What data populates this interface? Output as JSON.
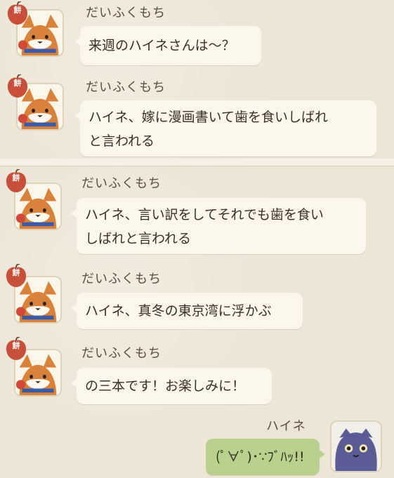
{
  "messages": [
    {
      "sender": "だいふくもち",
      "lines": [
        "来週のハイネさんは〜？"
      ],
      "badge": "餅"
    },
    {
      "sender": "だいふくもち",
      "lines": [
        "ハイネ、嫁に漫画書いて歯を食いしばれ",
        "と言われる"
      ],
      "badge": "餅"
    },
    {
      "sender": "だいふくもち",
      "lines": [
        "ハイネ、言い訳をしてそれでも歯を食い",
        "しばれと言われる"
      ],
      "badge": "餅"
    },
    {
      "sender": "だいふくもち",
      "lines": [
        "ハイネ、真冬の東京湾に浮かぶ"
      ],
      "badge": "餅"
    },
    {
      "sender": "だいふくもち",
      "lines": [
        "の三本です！お楽しみに！"
      ],
      "badge": "餅"
    },
    {
      "sender": "ハイネ",
      "lines": [
        "(ﾟ∀ﾟ)･∵ﾌﾞﾊｯ!!"
      ]
    }
  ],
  "colors": {
    "background": "#ede5d5",
    "bubble": "#fbf7ec",
    "bubble_self": "#b9d18f",
    "badge": "#c8503a"
  },
  "icons": {
    "avatar_left": "fox-avatar-icon",
    "avatar_right": "purple-cat-avatar-icon",
    "badge": "mochi-badge-icon"
  }
}
